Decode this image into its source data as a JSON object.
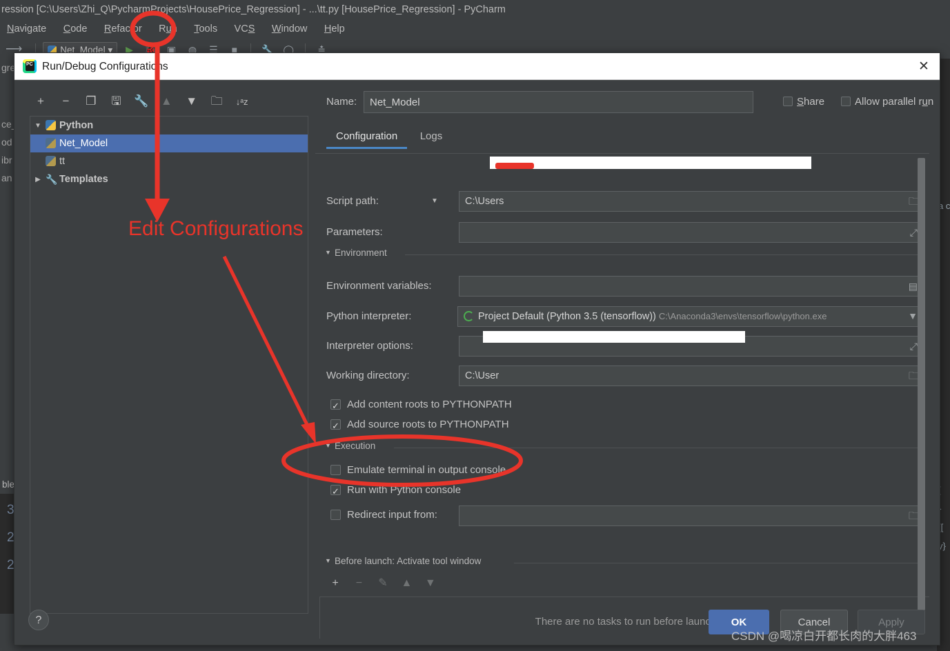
{
  "ide": {
    "title": "ression [C:\\Users\\Zhi_Q\\PycharmProjects\\HousePrice_Regression] - ...\\tt.py [HousePrice_Regression] - PyCharm",
    "menus": [
      {
        "label": "Navigate",
        "mnemonic": "N"
      },
      {
        "label": "Code",
        "mnemonic": "C"
      },
      {
        "label": "Refactor",
        "mnemonic": "R"
      },
      {
        "label": "Run",
        "mnemonic": "u"
      },
      {
        "label": "Tools",
        "mnemonic": "T"
      },
      {
        "label": "VCS",
        "mnemonic": "S"
      },
      {
        "label": "Window",
        "mnemonic": "W"
      },
      {
        "label": "Help",
        "mnemonic": "H"
      }
    ],
    "toolbar": {
      "run_config_name": "Net_Model",
      "icons": [
        "run-icon",
        "debug-icon",
        "coverage-icon",
        "profile-icon",
        "run-with-console-icon",
        "stop-icon",
        "settings-icon",
        "search-everywhere-icon",
        "layout-icon"
      ]
    },
    "left_tree_fragments": [
      "gre",
      "ce_",
      "od",
      "",
      "ibr",
      "an"
    ],
    "left_tab_fragment": "ble",
    "left_line_numbers": [
      "3",
      "2",
      "2"
    ],
    "right_code_fragments": [
      "a c",
      "[ ",
      "}",
      "[[",
      "y}"
    ]
  },
  "dialog": {
    "title": "Run/Debug Configurations",
    "close_label": "✕",
    "tree_toolbar": [
      {
        "name": "add-icon",
        "glyph": "+",
        "dim": false
      },
      {
        "name": "remove-icon",
        "glyph": "−",
        "dim": false
      },
      {
        "name": "copy-icon",
        "glyph": "❐",
        "dim": false
      },
      {
        "name": "save-icon",
        "glyph": "🖫",
        "dim": false
      },
      {
        "name": "wrench-icon",
        "glyph": "🔧",
        "dim": false
      },
      {
        "name": "move-up-icon",
        "glyph": "▲",
        "dim": true
      },
      {
        "name": "move-down-icon",
        "glyph": "▼",
        "dim": false
      },
      {
        "name": "new-folder-icon",
        "glyph": "🗀",
        "dim": false
      },
      {
        "name": "sort-alphabetically-icon",
        "glyph": "↓ᵃz",
        "dim": false
      }
    ],
    "tree": [
      {
        "label": "Python",
        "level": 0,
        "twisty": "▼",
        "icon": "python-icon",
        "bold": true,
        "selected": false
      },
      {
        "label": "Net_Model",
        "level": 1,
        "twisty": "",
        "icon": "python-icon-dim",
        "bold": false,
        "selected": true
      },
      {
        "label": "tt",
        "level": 1,
        "twisty": "",
        "icon": "python-icon-dim",
        "bold": false,
        "selected": false
      },
      {
        "label": "Templates",
        "level": 0,
        "twisty": "▶",
        "icon": "wrench-icon",
        "bold": true,
        "selected": false
      }
    ],
    "name": {
      "label": "Name:",
      "value": "Net_Model"
    },
    "share": {
      "label": "Share",
      "mnemonic": "S",
      "checked": false
    },
    "allow_parallel": {
      "label": "Allow parallel run",
      "mnemonic": "u",
      "checked": false
    },
    "tabs": [
      {
        "label": "Configuration",
        "active": true
      },
      {
        "label": "Logs",
        "active": false
      }
    ],
    "fields": {
      "script_path": {
        "label": "Script path:",
        "value": "C:\\Users",
        "redacted": true
      },
      "parameters": {
        "label": "Parameters:",
        "value": ""
      },
      "environment_section": "Environment",
      "env_vars": {
        "label": "Environment variables:",
        "value": ""
      },
      "interpreter": {
        "label": "Python interpreter:",
        "value": "Project Default (Python 3.5 (tensorflow))",
        "path": "C:\\Anaconda3\\envs\\tensorflow\\python.exe"
      },
      "interpreter_options": {
        "label": "Interpreter options:",
        "value": ""
      },
      "working_directory": {
        "label": "Working directory:",
        "value": "C:\\User",
        "redacted": true
      }
    },
    "path_checkboxes": [
      {
        "label": "Add content roots to PYTHONPATH",
        "checked": true
      },
      {
        "label": "Add source roots to PYTHONPATH",
        "checked": true
      }
    ],
    "execution_section": "Execution",
    "execution_checkboxes": [
      {
        "label": "Emulate terminal in output console",
        "checked": false
      },
      {
        "label": "Run with Python console",
        "checked": true
      },
      {
        "label": "Redirect input from:",
        "checked": false
      }
    ],
    "before_launch": {
      "section": "Before launch: Activate tool window",
      "toolbar": [
        {
          "name": "add-task-icon",
          "glyph": "+",
          "dim": false
        },
        {
          "name": "remove-task-icon",
          "glyph": "−",
          "dim": true
        },
        {
          "name": "edit-task-icon",
          "glyph": "✎",
          "dim": true
        },
        {
          "name": "move-task-up-icon",
          "glyph": "▲",
          "dim": true
        },
        {
          "name": "move-task-down-icon",
          "glyph": "▼",
          "dim": true
        }
      ],
      "empty_text": "There are no tasks to run before launch"
    },
    "buttons": {
      "help": "?",
      "ok": "OK",
      "cancel": "Cancel",
      "apply": "Apply"
    }
  },
  "annotations": {
    "edit_configurations_label": "Edit Configurations",
    "color": "#e8342a"
  },
  "watermark": "CSDN @喝凉白开都长肉的大胖463"
}
